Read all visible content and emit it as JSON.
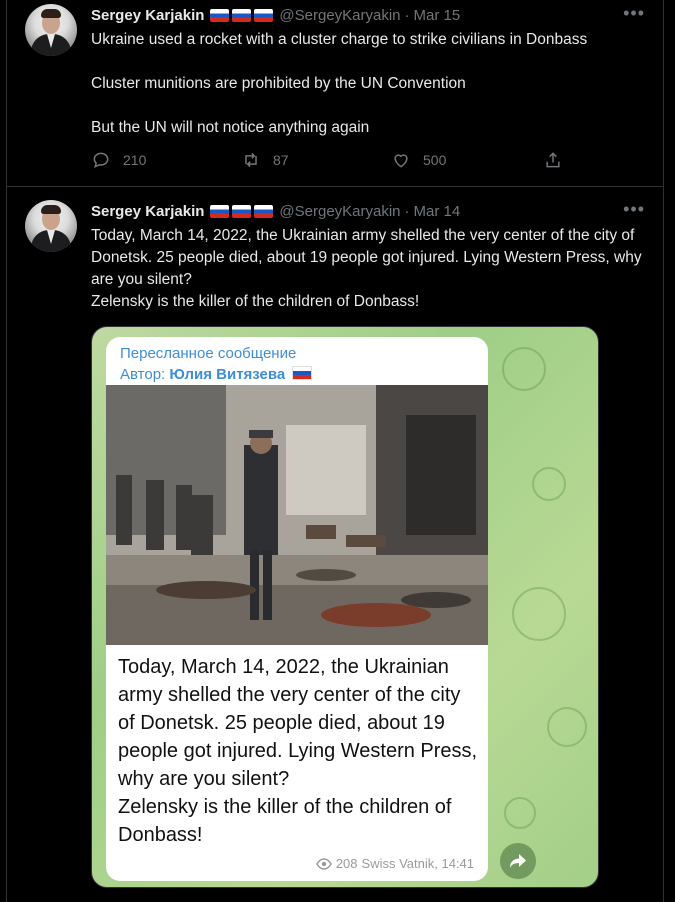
{
  "tweets": [
    {
      "author": "Sergey Karjakin",
      "handle": "@SergeyKaryakin",
      "separator": "·",
      "date": "Mar 15",
      "lines": [
        "Ukraine used a rocket with a cluster charge to strike civilians in Donbass",
        "Cluster munitions are prohibited by the UN Convention",
        "But the UN will not notice anything again"
      ],
      "replies": "210",
      "retweets": "87",
      "likes": "500"
    },
    {
      "author": "Sergey Karjakin",
      "handle": "@SergeyKaryakin",
      "separator": "·",
      "date": "Mar 14",
      "text": "Today, March 14, 2022, the Ukrainian army shelled the very center of the city of Donetsk. 25 people died, about 19 people got injured. Lying Western Press, why are you silent?",
      "text2": "Zelensky is the killer of the children of Donbass!",
      "media": {
        "forwarded_label": "Пересланное сообщение",
        "author_prefix": "Автор:",
        "author_name": "Юлия Витязева",
        "caption": "Today, March 14, 2022, the Ukrainian army shelled the very center of the city of Donetsk. 25 people died, about 19 people got injured. Lying Western Press, why are you silent?",
        "caption2": "Zelensky is the killer of the children of Donbass!",
        "views": "208",
        "channel": "Swiss Vatnik, 14:41"
      }
    }
  ],
  "icons": {
    "reply": "reply-icon",
    "retweet": "retweet-icon",
    "like": "heart-icon",
    "share": "share-icon",
    "more": "more-icon",
    "flag": "russia-flag-icon"
  },
  "colors": {
    "background": "#000000",
    "text": "#e7e9ea",
    "muted": "#71767b",
    "telegram_link": "#3e8ed6",
    "telegram_bg": "#a3cf89"
  }
}
